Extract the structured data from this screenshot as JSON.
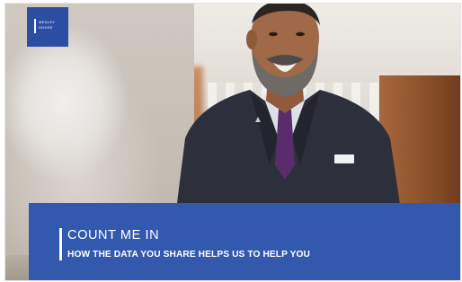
{
  "brand": {
    "logo_line_1": "MEDLEY",
    "logo_line_2": "HOUSE",
    "accent_color": "#3359ae"
  },
  "banner": {
    "title": "COUNT ME IN",
    "subtitle": "HOW THE DATA YOU SHARE HELPS US TO HELP YOU"
  },
  "photo": {
    "name_badge_text": ""
  }
}
